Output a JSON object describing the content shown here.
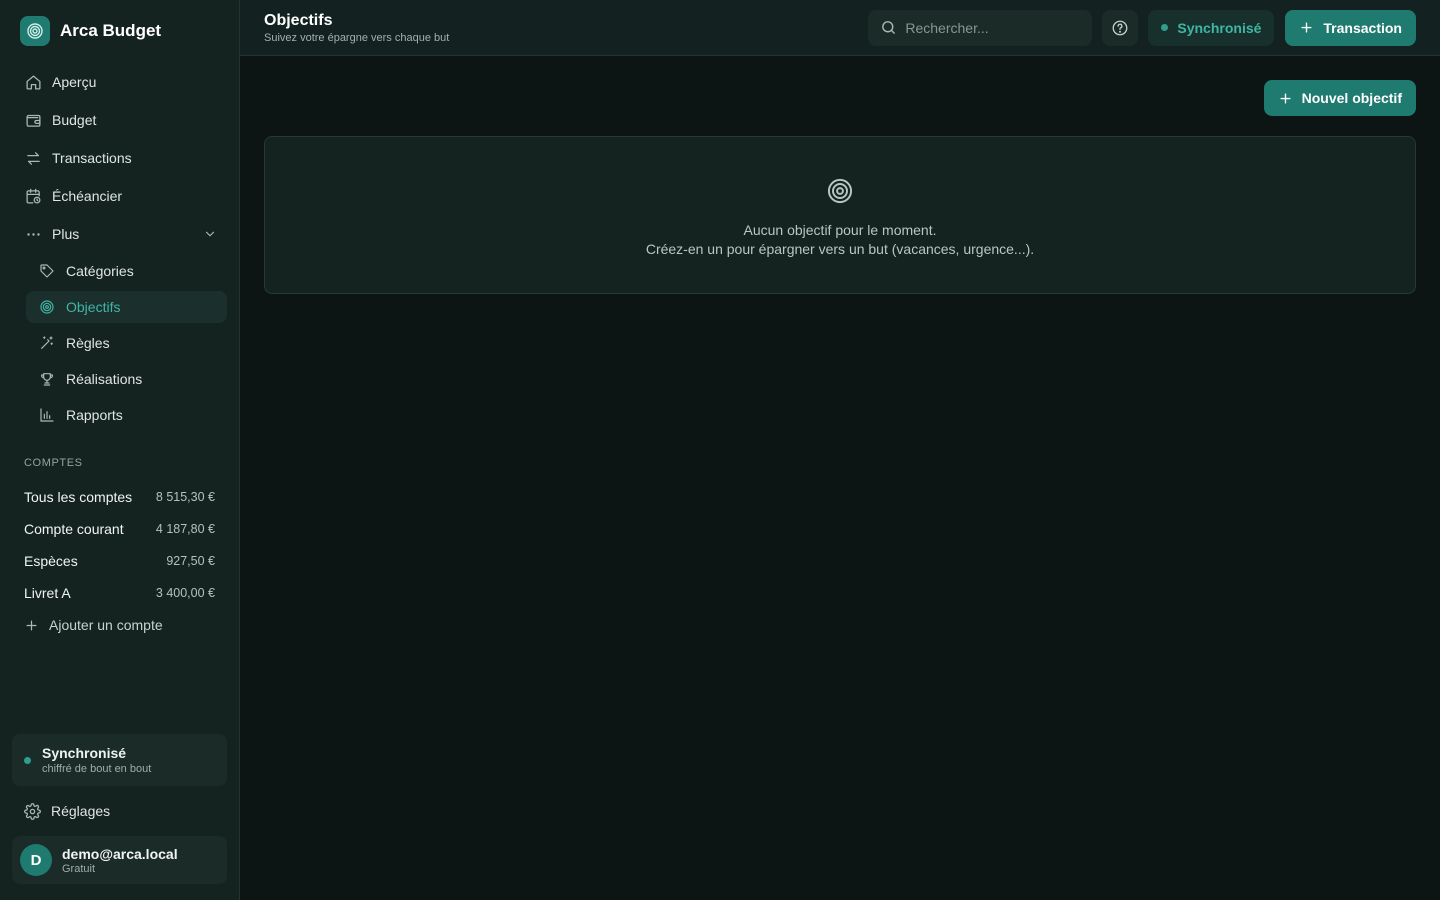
{
  "app": {
    "name": "Arca Budget"
  },
  "nav": {
    "items": [
      {
        "label": "Aperçu",
        "icon": "home-icon"
      },
      {
        "label": "Budget",
        "icon": "wallet-icon"
      },
      {
        "label": "Transactions",
        "icon": "arrows-swap-icon"
      },
      {
        "label": "Échéancier",
        "icon": "calendar-clock-icon"
      },
      {
        "label": "Plus",
        "icon": "more-horizontal-icon"
      }
    ],
    "sub_items": [
      {
        "label": "Catégories",
        "icon": "tag-icon"
      },
      {
        "label": "Objectifs",
        "icon": "target-icon",
        "active": true
      },
      {
        "label": "Règles",
        "icon": "magic-wand-icon"
      },
      {
        "label": "Réalisations",
        "icon": "trophy-icon"
      },
      {
        "label": "Rapports",
        "icon": "bar-chart-icon"
      }
    ]
  },
  "accounts": {
    "section_title": "COMPTES",
    "items": [
      {
        "name": "Tous les comptes",
        "amount": "8 515,30 €"
      },
      {
        "name": "Compte courant",
        "amount": "4 187,80 €"
      },
      {
        "name": "Espèces",
        "amount": "927,50 €"
      },
      {
        "name": "Livret A",
        "amount": "3 400,00 €"
      }
    ],
    "add_label": "Ajouter un compte"
  },
  "sidebar_footer": {
    "sync_title": "Synchronisé",
    "sync_sub": "chiffré de bout en bout",
    "settings_label": "Réglages",
    "user_initial": "D",
    "user_email": "demo@arca.local",
    "user_plan": "Gratuit"
  },
  "header": {
    "title": "Objectifs",
    "subtitle": "Suivez votre épargne vers chaque but",
    "search_placeholder": "Rechercher...",
    "sync_status": "Synchronisé",
    "transaction_button": "Transaction"
  },
  "main": {
    "new_goal_button": "Nouvel objectif",
    "empty_line1": "Aucun objectif pour le moment.",
    "empty_line2": "Créez-en un pour épargner vers un but (vacances, urgence...)."
  },
  "colors": {
    "accent": "#1f7a70",
    "accent_text": "#3fb5a6",
    "background": "#0c1513",
    "sidebar": "#142320"
  }
}
